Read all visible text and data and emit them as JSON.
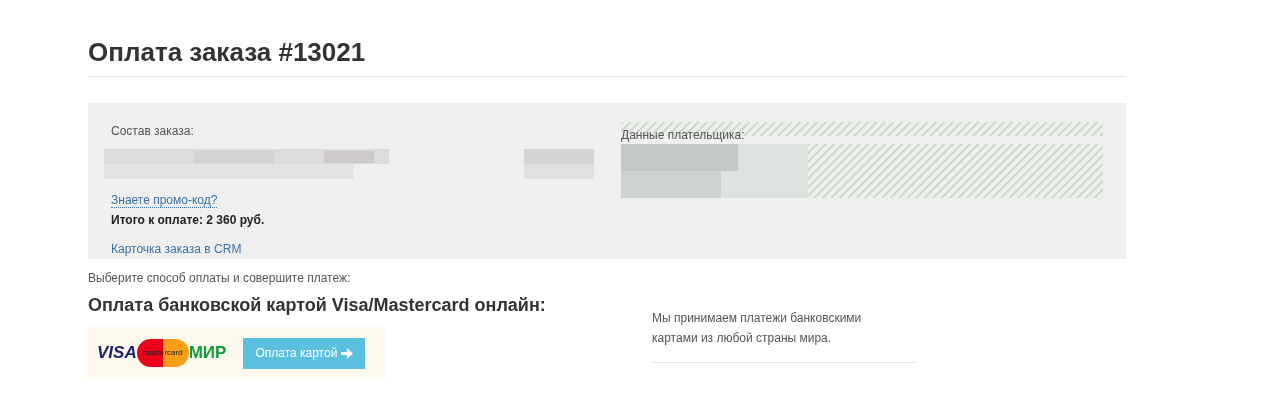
{
  "title": "Оплата заказа #13021",
  "order": {
    "label": "Состав заказа:",
    "promo_link": "Знаете промо-код?",
    "total": "Итого к оплате: 2 360 руб.",
    "crm_link": "Карточка заказа в CRM"
  },
  "payer": {
    "label": "Данные плательщика:"
  },
  "prompt": "Выберите способ оплаты и совершите платеж:",
  "method": {
    "heading": "Оплата банковской картой Visa/Mastercard онлайн:",
    "logos": [
      {
        "kind": "visa",
        "text": "VISA"
      },
      {
        "kind": "mastercard",
        "text": "mastercard"
      },
      {
        "kind": "mir",
        "text": "МИР"
      }
    ],
    "button": "Оплата картой",
    "note": "Мы принимаем платежи банковскими картами из любой страны мира."
  }
}
